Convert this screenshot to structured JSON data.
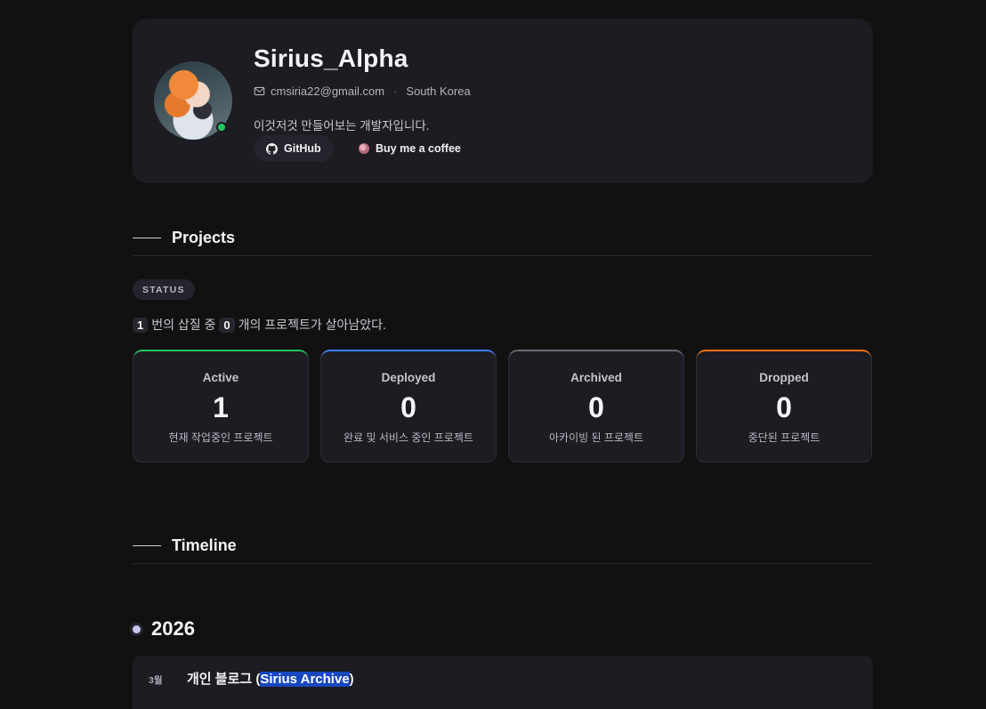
{
  "profile": {
    "name": "Sirius_Alpha",
    "email": "cmsiria22@gmail.com",
    "separator": "·",
    "location": "South Korea",
    "bio": "이것저것 만들어보는 개발자입니다.",
    "github_label": "GitHub",
    "coffee_label": "Buy me a coffee"
  },
  "projects": {
    "heading": "Projects",
    "status_label": "STATUS",
    "summary": {
      "attempts": "1",
      "text_a": "번의 삽질 중",
      "survived": "0",
      "text_b": "개의 프로젝트가 살아남았다."
    },
    "cards": [
      {
        "label": "Active",
        "count": "1",
        "desc": "현재 작업중인 프로젝트",
        "color": "#22c55e"
      },
      {
        "label": "Deployed",
        "count": "0",
        "desc": "완료 및 서비스 중인 프로젝트",
        "color": "#3b82f6"
      },
      {
        "label": "Archived",
        "count": "0",
        "desc": "아카이빙 된 프로젝트",
        "color": "#6b6b73"
      },
      {
        "label": "Dropped",
        "count": "0",
        "desc": "중단된 프로젝트",
        "color": "#f97316"
      }
    ]
  },
  "timeline": {
    "heading": "Timeline",
    "year": "2026",
    "entries": [
      {
        "month": "3월",
        "title_prefix": "개인 블로그 (",
        "title_highlight": "Sirius Archive",
        "title_suffix": ")"
      }
    ]
  }
}
